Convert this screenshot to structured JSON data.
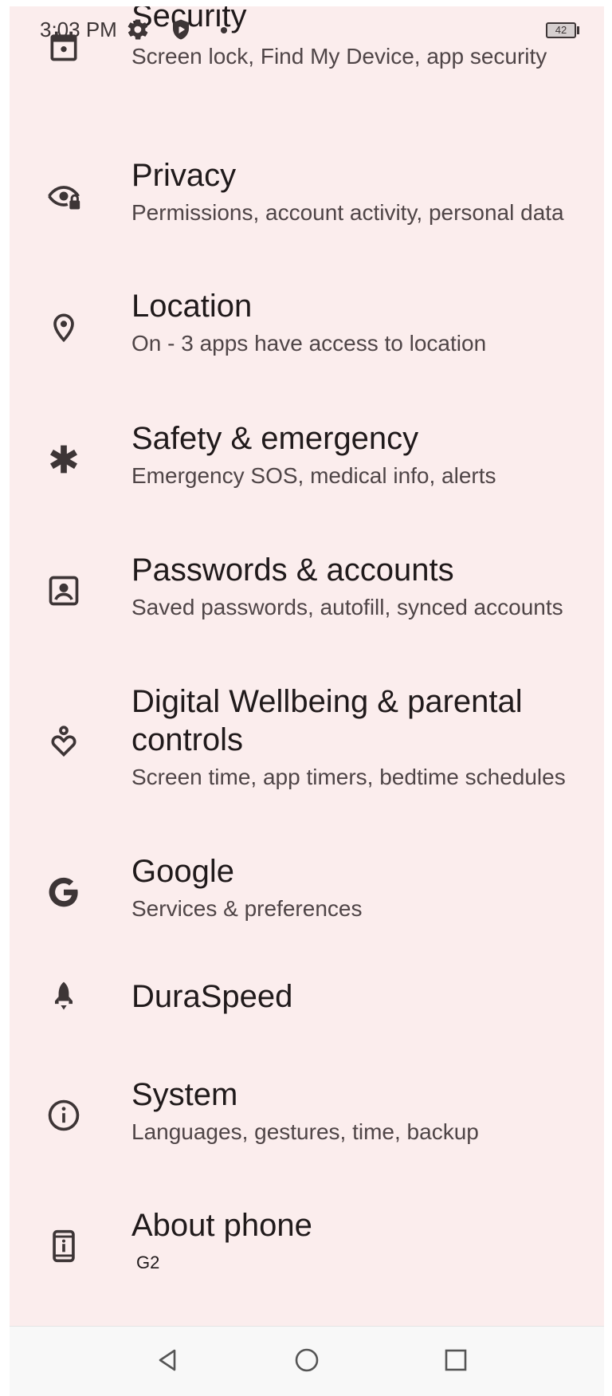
{
  "status_bar": {
    "time": "3:03 PM",
    "icons": [
      "gear-icon",
      "shield-play-icon",
      "dot-icon"
    ],
    "battery_level": "42"
  },
  "settings": [
    {
      "title": "Security",
      "subtitle": "Screen lock, Find My Device, app security",
      "icon": "calendar-lock-icon"
    },
    {
      "title": "Privacy",
      "subtitle": "Permissions, account activity, personal data",
      "icon": "eye-lock-icon"
    },
    {
      "title": "Location",
      "subtitle": "On - 3 apps have access to location",
      "icon": "location-pin-icon"
    },
    {
      "title": "Safety & emergency",
      "subtitle": "Emergency SOS, medical info, alerts",
      "icon": "asterisk-icon"
    },
    {
      "title": "Passwords & accounts",
      "subtitle": "Saved passwords, autofill, synced accounts",
      "icon": "account-box-icon"
    },
    {
      "title_line1": "Digital Wellbeing & parental",
      "title_line2": "controls",
      "subtitle": "Screen time, app timers, bedtime schedules",
      "icon": "wellbeing-heart-icon"
    },
    {
      "title": "Google",
      "subtitle": "Services & preferences",
      "icon": "google-g-icon"
    },
    {
      "title": "DuraSpeed",
      "icon": "rocket-icon"
    },
    {
      "title": "System",
      "subtitle": "Languages, gestures, time, backup",
      "icon": "info-icon"
    },
    {
      "title": "About phone",
      "subtitle": "G2",
      "icon": "phone-info-icon"
    }
  ],
  "nav_bar": {
    "buttons": [
      "back-icon",
      "home-icon",
      "recents-icon"
    ]
  },
  "colors": {
    "background": "#fbeded",
    "text_primary": "#201a1b",
    "text_secondary": "#4f4547",
    "icon": "#3d3536"
  }
}
